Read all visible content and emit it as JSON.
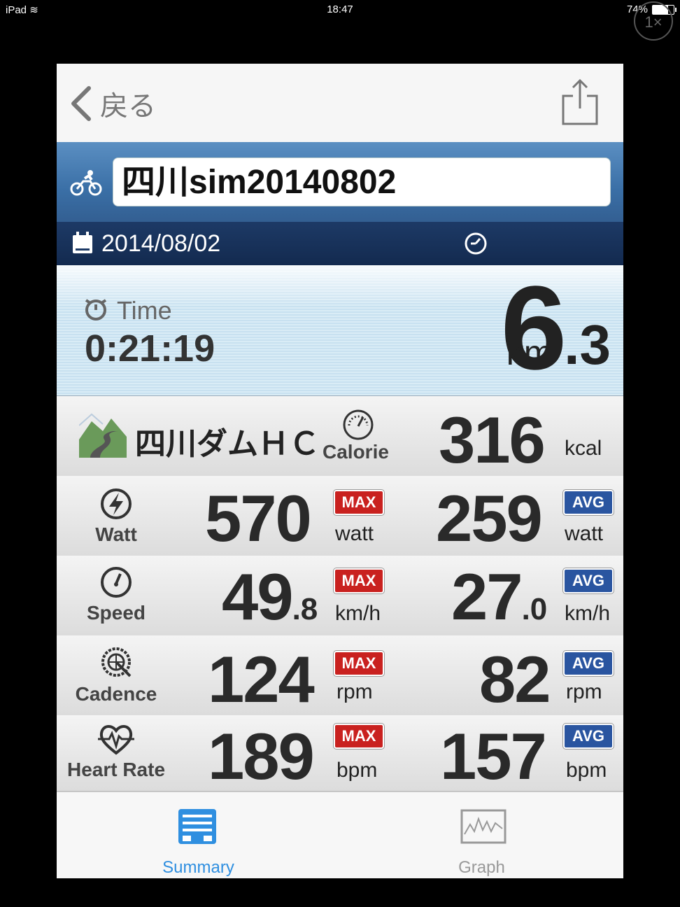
{
  "status": {
    "carrier": "iPad",
    "time": "18:47",
    "battery": "74%",
    "battery_level": 0.74
  },
  "zoom": {
    "label": "1×"
  },
  "nav": {
    "back_label": "戻る",
    "share_icon": "share-icon"
  },
  "activity": {
    "title": "四川sim20140802",
    "date": "2014/08/02"
  },
  "summary": {
    "time_label": "Time",
    "time_value": "0:21:19",
    "distance_int": "6",
    "distance_dec": ".3",
    "distance_unit": "km"
  },
  "course": {
    "name": "四川ダムＨＣ",
    "calorie_label": "Calorie",
    "calorie_value": "316",
    "calorie_unit": "kcal"
  },
  "badges": {
    "max": "MAX",
    "avg": "AVG"
  },
  "metrics": [
    {
      "label": "Watt",
      "max_int": "570",
      "max_dec": "",
      "max_unit": "watt",
      "avg_int": "259",
      "avg_dec": "",
      "avg_unit": "watt"
    },
    {
      "label": "Speed",
      "max_int": "49",
      "max_dec": ".8",
      "max_unit": "km/h",
      "avg_int": "27",
      "avg_dec": ".0",
      "avg_unit": "km/h"
    },
    {
      "label": "Cadence",
      "max_int": "124",
      "max_dec": "",
      "max_unit": "rpm",
      "avg_int": "82",
      "avg_dec": "",
      "avg_unit": "rpm"
    },
    {
      "label": "Heart Rate",
      "max_int": "189",
      "max_dec": "",
      "max_unit": "bpm",
      "avg_int": "157",
      "avg_dec": "",
      "avg_unit": "bpm"
    }
  ],
  "tabs": [
    {
      "label": "Summary",
      "active": true
    },
    {
      "label": "Graph",
      "active": false
    }
  ],
  "colors": {
    "active_tab": "#2f8fe0",
    "inactive_tab": "#999999",
    "max_badge": "#c9211f",
    "avg_badge": "#2a55a0"
  }
}
